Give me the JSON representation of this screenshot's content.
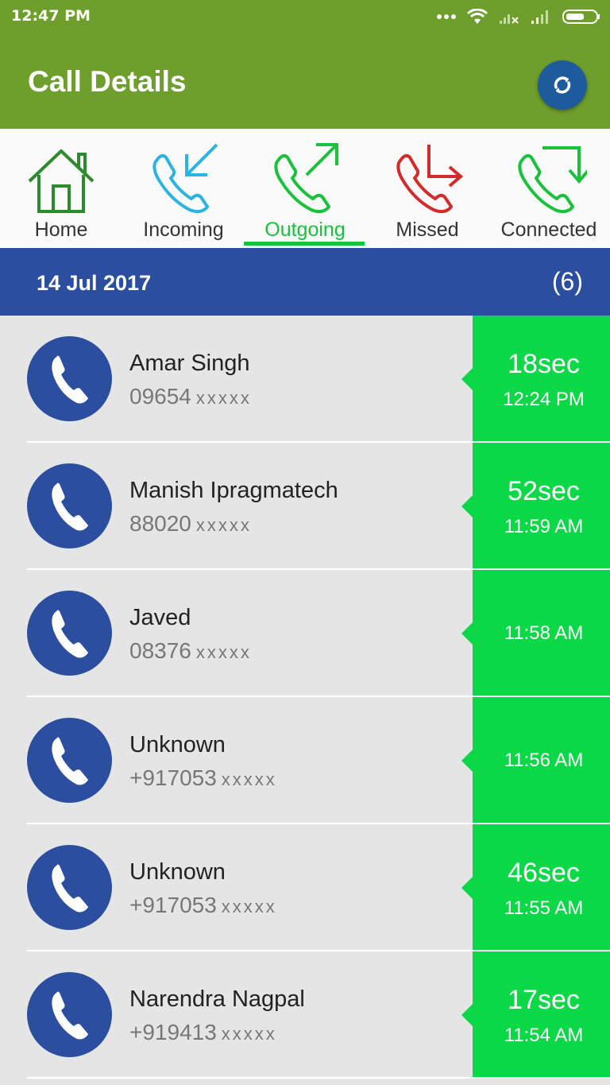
{
  "status_bar": {
    "time": "12:47 PM",
    "icons": [
      "more-dots-icon",
      "wifi-icon",
      "signal-x-icon",
      "signal-icon",
      "battery-icon"
    ]
  },
  "app_bar": {
    "title": "Call Details",
    "refresh_icon": "refresh-icon"
  },
  "colors": {
    "app_bar": "#6e9e2c",
    "active_tab": "#18c23a",
    "date_header": "#2b4f9e",
    "duration_panel": "#0bd846",
    "incoming": "#2bb3e3",
    "missed": "#d42a2a",
    "home": "#2e8a2e"
  },
  "tabs": [
    {
      "label": "Home",
      "icon": "home-icon"
    },
    {
      "label": "Incoming",
      "icon": "incoming-call-icon"
    },
    {
      "label": "Outgoing",
      "icon": "outgoing-call-icon",
      "active": true
    },
    {
      "label": "Missed",
      "icon": "missed-call-icon"
    },
    {
      "label": "Connected",
      "icon": "connected-call-icon"
    }
  ],
  "date_header": {
    "date": "14 Jul 2017",
    "count": "(6)"
  },
  "calls": [
    {
      "name": "Amar Singh",
      "number": "09654",
      "masked": "xxxxx",
      "duration": "18sec",
      "time": "12:24 PM"
    },
    {
      "name": "Manish Ipragmatech",
      "number": "88020",
      "masked": "xxxxx",
      "duration": "52sec",
      "time": "11:59 AM"
    },
    {
      "name": "Javed",
      "number": "08376",
      "masked": "xxxxx",
      "duration": "",
      "time": "11:58 AM"
    },
    {
      "name": "Unknown",
      "number": "+917053",
      "masked": "xxxxx",
      "duration": "",
      "time": "11:56 AM"
    },
    {
      "name": "Unknown",
      "number": "+917053",
      "masked": "xxxxx",
      "duration": "46sec",
      "time": "11:55 AM"
    },
    {
      "name": "Narendra Nagpal",
      "number": "+919413",
      "masked": "xxxxx",
      "duration": "17sec",
      "time": "11:54 AM"
    }
  ]
}
